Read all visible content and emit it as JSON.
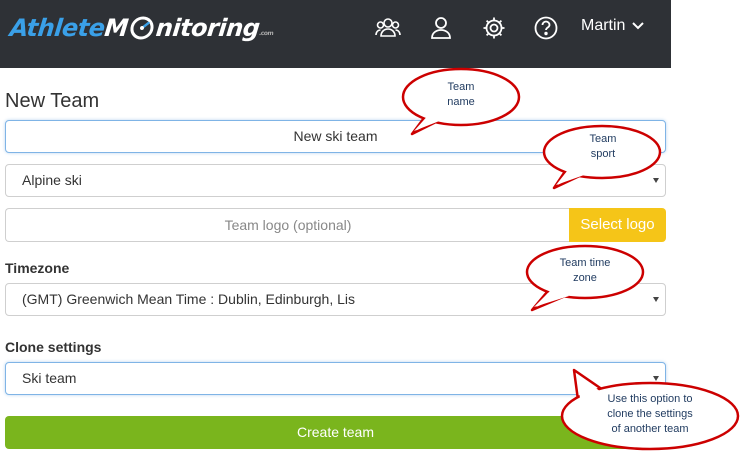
{
  "header": {
    "logo_part1": "Athlete",
    "logo_part2": "M",
    "logo_part3": "nitoring",
    "logo_suffix": ".com",
    "user_name": "Martin",
    "accent_color": "#3aa0e8",
    "bg_color": "#2e3136",
    "icons": [
      "team-icon",
      "user-icon",
      "gear-icon",
      "help-icon",
      "chevron-down-icon"
    ]
  },
  "form": {
    "title": "New Team",
    "team_name_value": "New ski team",
    "sport_value": "Alpine ski",
    "logo_placeholder": "Team logo (optional)",
    "select_logo_label": "Select logo",
    "timezone_label": "Timezone",
    "timezone_value": "(GMT) Greenwich Mean Time : Dublin, Edinburgh, Lis",
    "clone_label": "Clone settings",
    "clone_value": "Ski team",
    "create_button_label": "Create team",
    "select_logo_color": "#f5c518",
    "create_button_color": "#7ab51d"
  },
  "callouts": {
    "team_name_1": "Team",
    "team_name_2": "name",
    "team_sport_1": "Team",
    "team_sport_2": "sport",
    "timezone_1": "Team time",
    "timezone_2": "zone",
    "clone_1": "Use this option to",
    "clone_2": "clone the settings",
    "clone_3": "of another team",
    "border_color": "#cc0000"
  }
}
